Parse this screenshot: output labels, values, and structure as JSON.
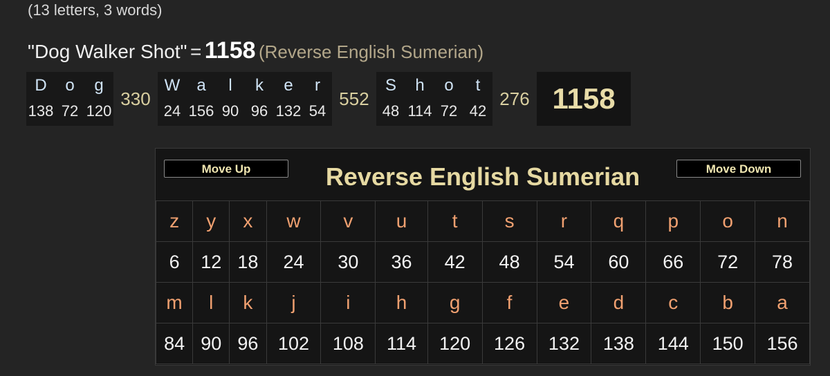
{
  "summary": {
    "count_text": "(13 letters, 3 words)"
  },
  "phrase": {
    "quoted": "\"Dog Walker Shot\"",
    "equals": "=",
    "total": "1158",
    "cipher": "(Reverse English Sumerian)"
  },
  "breakdown": {
    "words": [
      {
        "letters": [
          "D",
          "o",
          "g"
        ],
        "values": [
          "138",
          "72",
          "120"
        ],
        "subtotal": "330"
      },
      {
        "letters": [
          "W",
          "a",
          "l",
          "k",
          "e",
          "r"
        ],
        "values": [
          "24",
          "156",
          "90",
          "96",
          "132",
          "54"
        ],
        "subtotal": "552"
      },
      {
        "letters": [
          "S",
          "h",
          "o",
          "t"
        ],
        "values": [
          "48",
          "114",
          "72",
          "42"
        ],
        "subtotal": "276"
      }
    ],
    "grand_total": "1158"
  },
  "panel": {
    "title": "Reverse English Sumerian",
    "move_up": "Move Up",
    "move_down": "Move Down",
    "row1_letters": [
      "z",
      "y",
      "x",
      "w",
      "v",
      "u",
      "t",
      "s",
      "r",
      "q",
      "p",
      "o",
      "n"
    ],
    "row1_values": [
      "6",
      "12",
      "18",
      "24",
      "30",
      "36",
      "42",
      "48",
      "54",
      "60",
      "66",
      "72",
      "78"
    ],
    "row2_letters": [
      "m",
      "l",
      "k",
      "j",
      "i",
      "h",
      "g",
      "f",
      "e",
      "d",
      "c",
      "b",
      "a"
    ],
    "row2_values": [
      "84",
      "90",
      "96",
      "102",
      "108",
      "114",
      "120",
      "126",
      "132",
      "138",
      "144",
      "150",
      "156"
    ]
  }
}
